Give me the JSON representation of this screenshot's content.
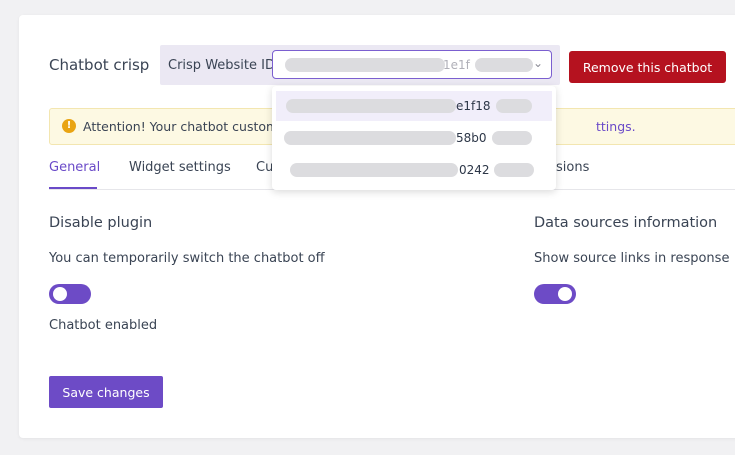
{
  "header": {
    "title": "Chatbot crisp",
    "crisp_id_label": "Crisp Website ID:",
    "selected_value_visible": "1e1f",
    "remove_button": "Remove this chatbot"
  },
  "dropdown": {
    "options": [
      {
        "visible_tail": "e1f18"
      },
      {
        "visible_tail": "58b0"
      },
      {
        "visible_tail": "0242"
      }
    ]
  },
  "alert": {
    "text": "Attention! Your chatbot custom",
    "link_tail": "ttings."
  },
  "tabs": [
    {
      "label": "General"
    },
    {
      "label": "Widget settings"
    },
    {
      "label": "Cu"
    },
    {
      "label": "sions"
    }
  ],
  "disable_plugin": {
    "heading": "Disable plugin",
    "description": "You can temporarily switch the chatbot off",
    "status": "Chatbot enabled",
    "toggle_on": false
  },
  "data_sources": {
    "heading": "Data sources information",
    "description": "Show source links in response",
    "toggle_on": true
  },
  "save_button": "Save changes",
  "colors": {
    "accent": "#6d4bc6",
    "danger": "#b5121f",
    "alert_bg": "#fdf9e3",
    "warning_icon": "#e9a413"
  }
}
